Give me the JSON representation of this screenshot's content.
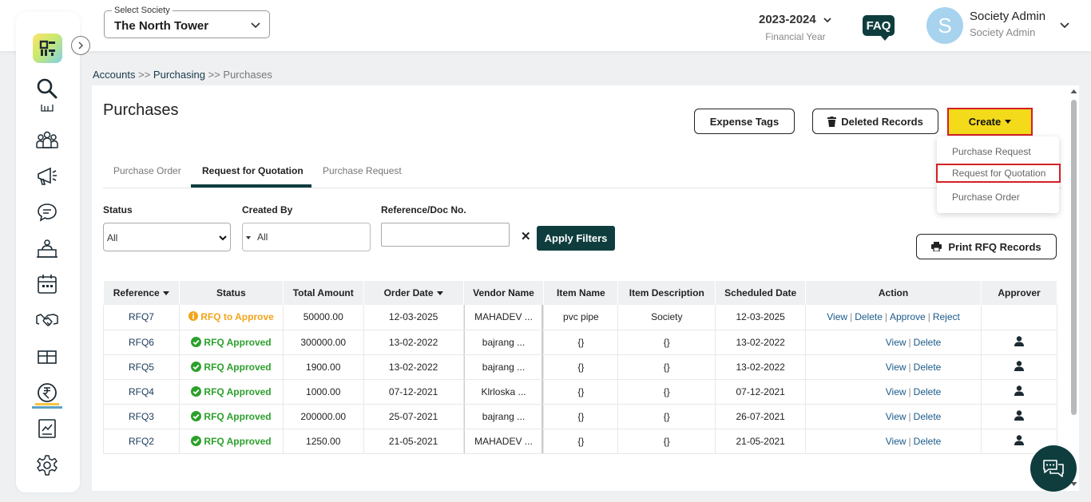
{
  "header": {
    "society_label": "Select Society",
    "society_value": "The North Tower",
    "financial_year": "2023-2024",
    "financial_year_label": "Financial Year",
    "faq": "FAQ",
    "avatar_initial": "S",
    "user_name": "Society Admin",
    "user_role": "Society Admin"
  },
  "breadcrumb": {
    "level1": "Accounts",
    "sep1": ">>",
    "level2": "Purchasing",
    "sep2": ">>",
    "level3": "Purchases"
  },
  "page": {
    "title": "Purchases",
    "expense_tags": "Expense Tags",
    "deleted_records": "Deleted Records",
    "create": "Create",
    "print_records": "Print RFQ Records"
  },
  "create_menu": [
    "Purchase Request",
    "Request for Quotation",
    "Purchase Order"
  ],
  "tabs": [
    "Purchase Order",
    "Request for Quotation",
    "Purchase Request"
  ],
  "filters": {
    "status_label": "Status",
    "status_value": "All",
    "created_by_label": "Created By",
    "created_by_value": "All",
    "ref_label": "Reference/Doc No.",
    "ref_value": "",
    "clear": "✕",
    "apply": "Apply Filters"
  },
  "table": {
    "headers": [
      "Reference",
      "Status",
      "Total Amount",
      "Order Date",
      "Vendor Name",
      "Item Name",
      "Item Description",
      "Scheduled Date",
      "Action",
      "Approver"
    ],
    "rows": [
      {
        "ref": "RFQ7",
        "status": "RFQ to Approve",
        "amount": "50000.00",
        "order_date": "12-03-2025",
        "vendor": "MAHADEV ...",
        "item": "pvc pipe",
        "desc": "Society",
        "sched": "12-03-2025"
      },
      {
        "ref": "RFQ6",
        "status": "RFQ Approved",
        "amount": "300000.00",
        "order_date": "13-02-2022",
        "vendor": "bajrang ...",
        "item": "{}",
        "desc": "{}",
        "sched": "13-02-2022"
      },
      {
        "ref": "RFQ5",
        "status": "RFQ Approved",
        "amount": "1900.00",
        "order_date": "13-02-2022",
        "vendor": "bajrang ...",
        "item": "{}",
        "desc": "{}",
        "sched": "13-02-2022"
      },
      {
        "ref": "RFQ4",
        "status": "RFQ Approved",
        "amount": "1000.00",
        "order_date": "07-12-2021",
        "vendor": "Klrloska ...",
        "item": "{}",
        "desc": "{}",
        "sched": "07-12-2021"
      },
      {
        "ref": "RFQ3",
        "status": "RFQ Approved",
        "amount": "200000.00",
        "order_date": "25-07-2021",
        "vendor": "bajrang ...",
        "item": "{}",
        "desc": "{}",
        "sched": "26-07-2021"
      },
      {
        "ref": "RFQ2",
        "status": "RFQ Approved",
        "amount": "1250.00",
        "order_date": "21-05-2021",
        "vendor": "MAHADEV ...",
        "item": "{}",
        "desc": "{}",
        "sched": "21-05-2021"
      }
    ],
    "actions": {
      "view": "View",
      "delete": "Delete",
      "approve": "Approve",
      "reject": "Reject",
      "sep": "|"
    }
  },
  "colors": {
    "brand": "#0f3d3e",
    "create_bg": "#f3da1a",
    "highlight": "#d32027",
    "approved": "#2ca02c",
    "pending": "#f0a51c"
  }
}
